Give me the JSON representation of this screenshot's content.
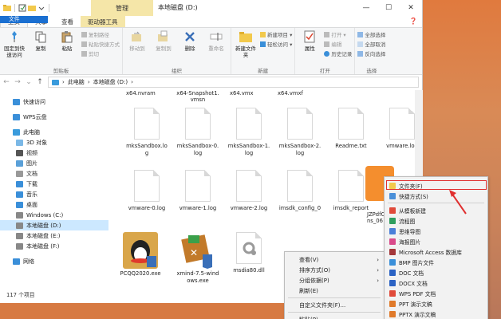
{
  "window": {
    "title": "本地磁盘 (D:)",
    "manage_tab": "管理",
    "controls": [
      "—",
      "☐",
      "✕"
    ]
  },
  "tabs": [
    "文件",
    "主页",
    "共享",
    "查看",
    "驱动器工具"
  ],
  "ribbon": {
    "clipboard": {
      "label": "剪贴板",
      "pin": "固定到快速访问",
      "copy": "复制",
      "paste": "粘贴",
      "copy_path": "复制路径",
      "paste_shortcut": "粘贴快捷方式",
      "cut": "剪切"
    },
    "organize": {
      "label": "组织",
      "move_to": "移动到",
      "copy_to": "复制到",
      "delete": "删除",
      "rename": "重命名"
    },
    "new": {
      "label": "新建",
      "new_folder": "新建文件夹",
      "new_item": "新建项目 ▾",
      "easy_access": "轻松访问 ▾"
    },
    "open": {
      "label": "打开",
      "properties": "属性",
      "open": "打开 ▾",
      "edit": "编辑",
      "history": "历史记录"
    },
    "select": {
      "label": "选择",
      "select_all": "全部选择",
      "select_none": "全部取消",
      "invert": "反向选择"
    }
  },
  "address": {
    "path": [
      "此电脑",
      "本地磁盘 (D:)"
    ],
    "separator": "›"
  },
  "sidebar": [
    {
      "label": "快速访问",
      "level": 1,
      "icon": "star-icon"
    },
    {
      "label": "WPS云盘",
      "level": 1,
      "icon": "cloud-icon"
    },
    {
      "label": "此电脑",
      "level": 1,
      "icon": "computer-icon"
    },
    {
      "label": "3D 对象",
      "level": 2,
      "icon": "cube-icon"
    },
    {
      "label": "视频",
      "level": 2,
      "icon": "video-icon"
    },
    {
      "label": "图片",
      "level": 2,
      "icon": "picture-icon"
    },
    {
      "label": "文档",
      "level": 2,
      "icon": "document-icon"
    },
    {
      "label": "下载",
      "level": 2,
      "icon": "download-icon"
    },
    {
      "label": "音乐",
      "level": 2,
      "icon": "music-icon"
    },
    {
      "label": "桌面",
      "level": 2,
      "icon": "desktop-icon"
    },
    {
      "label": "Windows (C:)",
      "level": 2,
      "icon": "drive-icon"
    },
    {
      "label": "本地磁盘 (D:)",
      "level": 2,
      "icon": "drive-icon",
      "selected": true
    },
    {
      "label": "本地磁盘 (E:)",
      "level": 2,
      "icon": "drive-icon"
    },
    {
      "label": "本地磁盘 (F:)",
      "level": 2,
      "icon": "drive-icon"
    },
    {
      "label": "网络",
      "level": 1,
      "icon": "network-icon"
    }
  ],
  "top_fragments": [
    "x64.nvram",
    "x64-Snapshot1.\nvmsn",
    "x64.vmx",
    "x64.vmxf"
  ],
  "files": [
    {
      "name": "mksSandbox.lo\ng"
    },
    {
      "name": "mksSandbox-0.\nlog"
    },
    {
      "name": "mksSandbox-1.\nlog"
    },
    {
      "name": "mksSandbox-2.\nlog"
    },
    {
      "name": "Readme.txt"
    },
    {
      "name": "vmware.log"
    },
    {
      "name": "vmware-0.log"
    },
    {
      "name": "vmware-1.log"
    },
    {
      "name": "vmware-2.log"
    },
    {
      "name": "imsdk_config_0"
    },
    {
      "name": "imsdk_report"
    },
    {
      "name": "PCQQ2020.exe"
    },
    {
      "name": "xmind-7.5-wind\nows.exe"
    },
    {
      "name": "msdia80.dll"
    }
  ],
  "desktop_item": {
    "label": "JZPdfC\nns_06"
  },
  "status": {
    "count": "117 个项目"
  },
  "context_menu": [
    {
      "label": "查看(V)",
      "arrow": true
    },
    {
      "label": "排序方式(O)",
      "arrow": true
    },
    {
      "label": "分组依据(P)",
      "arrow": true
    },
    {
      "label": "刷新(E)",
      "arrow": false
    },
    {
      "sep": true
    },
    {
      "label": "自定义文件夹(F)...",
      "arrow": false
    },
    {
      "sep": true
    },
    {
      "label": "粘贴(P)",
      "arrow": false
    }
  ],
  "submenu": [
    {
      "label": "文件夹(F)",
      "icon": "folder-icon",
      "color": "#f2c94c"
    },
    {
      "label": "快捷方式(S)",
      "icon": "shortcut-icon",
      "color": "#4a90d9"
    },
    {
      "sep": true
    },
    {
      "label": "从模板新建",
      "icon": "template-icon",
      "color": "#e04a3a"
    },
    {
      "label": "流程图",
      "icon": "flowchart-icon",
      "color": "#2f9e5f"
    },
    {
      "label": "思维导图",
      "icon": "mindmap-icon",
      "color": "#4a7fd9"
    },
    {
      "label": "海报图片",
      "icon": "poster-icon",
      "color": "#d94a8a"
    },
    {
      "label": "Microsoft Access 数据库",
      "icon": "access-icon",
      "color": "#a4373a"
    },
    {
      "label": "BMP 图片文件",
      "icon": "bmp-icon",
      "color": "#3a8fd9"
    },
    {
      "label": "DOC 文档",
      "icon": "doc-icon",
      "color": "#2b63c4"
    },
    {
      "label": "DOCX 文档",
      "icon": "docx-icon",
      "color": "#2b63c4"
    },
    {
      "label": "WPS PDF 文档",
      "icon": "pdf-icon",
      "color": "#e04a3a"
    },
    {
      "label": "PPT 演示文稿",
      "icon": "ppt-icon",
      "color": "#e07a2a"
    },
    {
      "label": "PPTX 演示文稿",
      "icon": "pptx-icon",
      "color": "#e07a2a"
    }
  ],
  "colors": {
    "accent": "#1a6fd1",
    "highlight": "#e03030",
    "selection": "#cce8ff"
  }
}
